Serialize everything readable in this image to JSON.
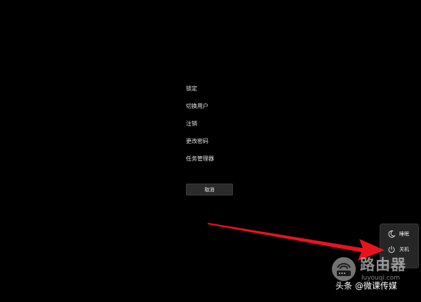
{
  "security_menu": {
    "items": [
      {
        "label": "锁定"
      },
      {
        "label": "切换用户"
      },
      {
        "label": "注销"
      },
      {
        "label": "更改密码"
      },
      {
        "label": "任务管理器"
      }
    ],
    "cancel_label": "取消"
  },
  "power_menu": {
    "items": [
      {
        "icon": "moon-icon",
        "label": "睡眠"
      },
      {
        "icon": "power-icon",
        "label": "关机"
      }
    ]
  },
  "annotation": {
    "arrow_color": "#e8141c"
  },
  "watermark": {
    "logo_text": "路由器",
    "logo_url": "luyouqi.com",
    "credit": "头条 @微课传媒"
  }
}
